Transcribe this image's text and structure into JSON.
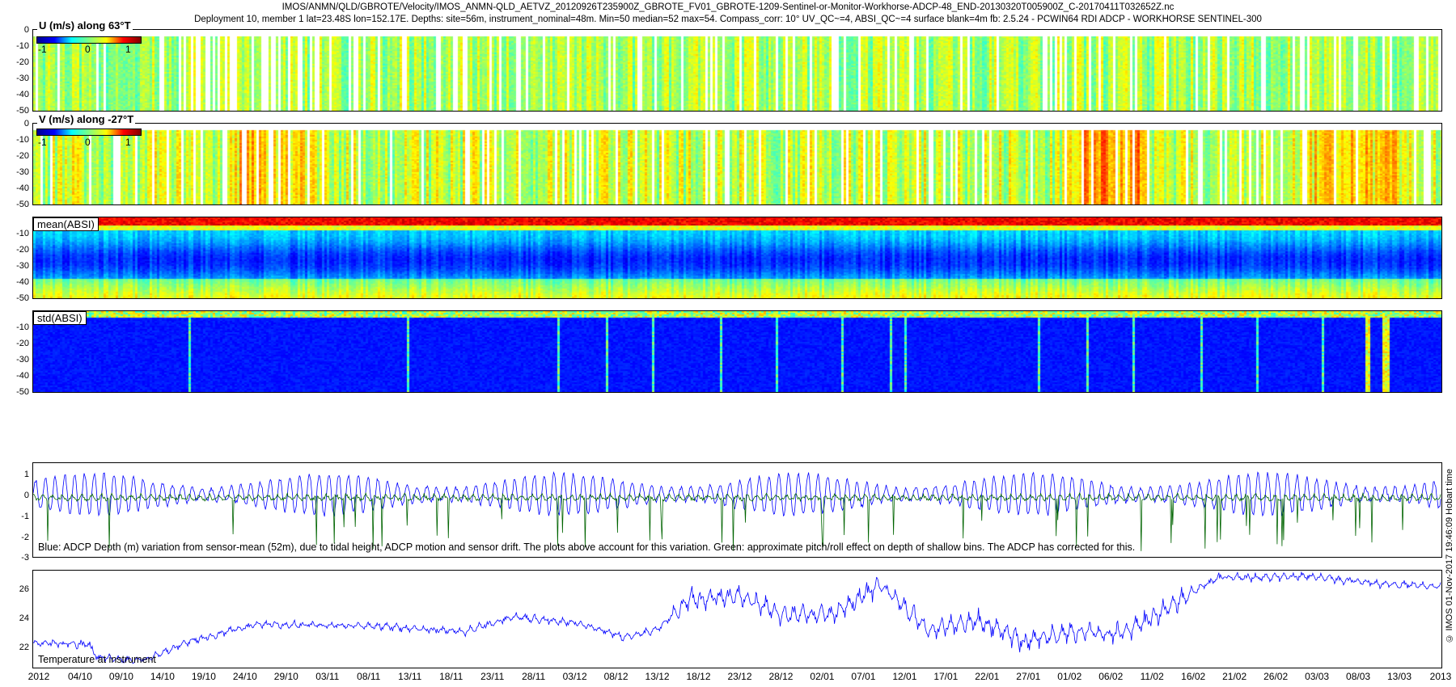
{
  "header": {
    "line1": "IMOS/ANMN/QLD/GBROTE/Velocity/IMOS_ANMN-QLD_AETVZ_20120926T235900Z_GBROTE_FV01_GBROTE-1209-Sentinel-or-Monitor-Workhorse-ADCP-48_END-20130320T005900Z_C-20170411T032652Z.nc",
    "line2": "Deployment 10, member 1 lat=23.48S lon=152.17E. Depths: site=56m, instrument_nominal=48m. Min=50 median=52 max=54. Compass_corr: 10° UV_QC~=4, ABSI_QC~=4 surface blank=4m fb: 2.5.24 - PCWIN64 RDI ADCP - WORKHORSE SENTINEL-300"
  },
  "chart_data": [
    {
      "type": "heatmap",
      "title": "U (m/s) along 63°T",
      "ylim": [
        -50,
        0
      ],
      "yticks": [
        "0",
        "-10",
        "-20",
        "-30",
        "-40",
        "-50"
      ],
      "colorbar": {
        "ticks": [
          "-1",
          "0",
          "1"
        ],
        "range": [
          -1,
          1
        ]
      },
      "value_summary": "mostly near 0 (green) with banded tidal fluctuations",
      "blank_surface_depth": -4
    },
    {
      "type": "heatmap",
      "title": "V (m/s) along -27°T",
      "ylim": [
        -50,
        0
      ],
      "yticks": [
        "0",
        "-10",
        "-20",
        "-30",
        "-40",
        "-50"
      ],
      "colorbar": {
        "ticks": [
          "-1",
          "0",
          "1"
        ],
        "range": [
          -1,
          1
        ]
      },
      "value_summary": "near 0 with periods of positive (yellow/red) values around 10/10, 12/11, 20/01, 11/03"
    },
    {
      "type": "heatmap",
      "title": "mean(ABSI)",
      "ylim": [
        -50,
        0
      ],
      "yticks": [
        "-10",
        "-20",
        "-30",
        "-40",
        "-50"
      ],
      "value_summary": "high near surface (red/orange), low (blue) mid-column, moderate (green/yellow) near bottom"
    },
    {
      "type": "heatmap",
      "title": "std(ABSI)",
      "ylim": [
        -50,
        0
      ],
      "yticks": [
        "-10",
        "-20",
        "-30",
        "-40",
        "-50"
      ],
      "value_summary": "mostly low (dark blue) with sparse vertical spikes, larger near mid-March"
    },
    {
      "type": "line",
      "ylim": [
        -3,
        1.5
      ],
      "yticks": [
        "1",
        "0",
        "-1",
        "-2",
        "-3"
      ],
      "series": [
        {
          "name": "ADCP Depth variation",
          "color": "#0000ff",
          "description": "tidal oscillation roughly -1 to 1 m"
        },
        {
          "name": "pitch/roll effect",
          "color": "#006400",
          "description": "mostly 0 to -1, spikes down to -3"
        }
      ],
      "annotation": "Blue: ADCP Depth (m) variation from sensor-mean (52m), due to tidal height, ADCP motion and sensor drift. The plots above account for this variation. Green: approximate pitch/roll effect on depth of shallow bins. The ADCP has corrected for this."
    },
    {
      "type": "line",
      "ylim": [
        20.5,
        27.2
      ],
      "yticks": [
        "26",
        "24",
        "22"
      ],
      "series": [
        {
          "name": "Temperature at instrument",
          "color": "#0000ff",
          "x_day": [
            0,
            7,
            8,
            14,
            20,
            28,
            42,
            54,
            60,
            68,
            74,
            78,
            82,
            88,
            94,
            100,
            106,
            112,
            118,
            124,
            130,
            136,
            140,
            148,
            160,
            168,
            176
          ],
          "values": [
            22.2,
            22.1,
            21.2,
            21.0,
            22.4,
            23.5,
            23.4,
            23.0,
            24.0,
            23.6,
            22.6,
            23.1,
            25.2,
            25.5,
            24.1,
            24.2,
            26.2,
            23.0,
            23.8,
            22.3,
            23.0,
            22.8,
            24.0,
            26.7,
            26.8,
            26.3,
            26.1
          ]
        }
      ],
      "label": "Temperature at instrument"
    }
  ],
  "xaxis": {
    "ticks": [
      "2012",
      "04/10",
      "09/10",
      "14/10",
      "19/10",
      "24/10",
      "29/10",
      "03/11",
      "08/11",
      "13/11",
      "18/11",
      "23/11",
      "28/11",
      "03/12",
      "08/12",
      "13/12",
      "18/12",
      "23/12",
      "28/12",
      "02/01",
      "07/01",
      "12/01",
      "17/01",
      "22/01",
      "27/01",
      "01/02",
      "06/02",
      "11/02",
      "16/02",
      "21/02",
      "26/02",
      "03/03",
      "08/03",
      "13/03",
      "2013"
    ]
  },
  "sidebar_text": "© IMOS 01-Nov-2017 19:46:09 Hobart time"
}
